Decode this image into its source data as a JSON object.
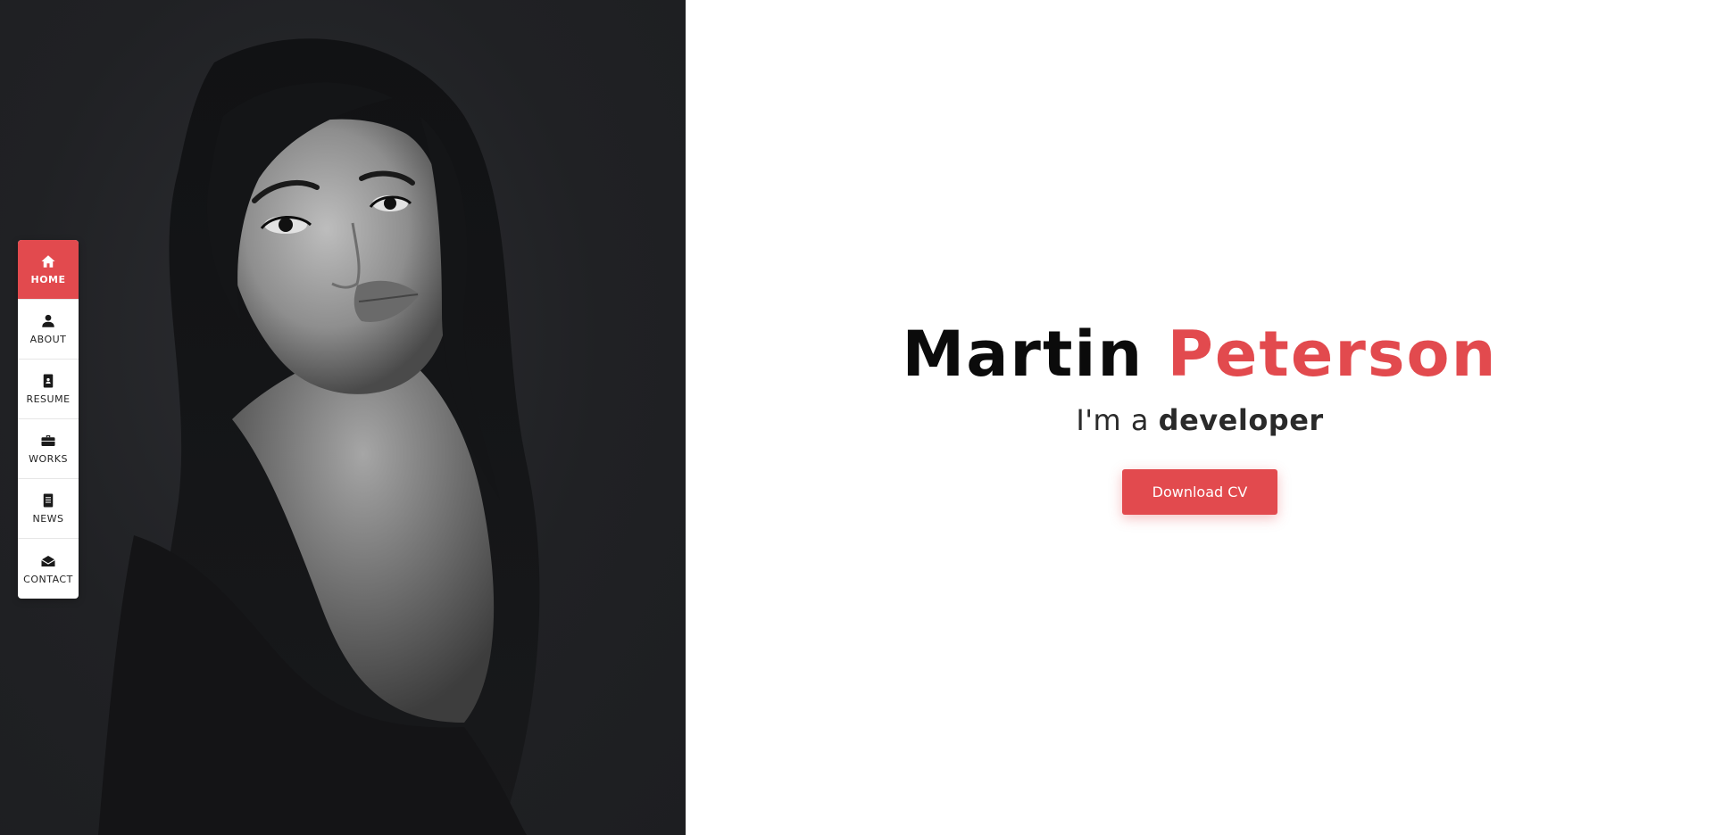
{
  "nav": {
    "items": [
      {
        "label": "HOME",
        "icon": "home-icon",
        "active": true
      },
      {
        "label": "ABOUT",
        "icon": "user-icon",
        "active": false
      },
      {
        "label": "RESUME",
        "icon": "id-card-icon",
        "active": false
      },
      {
        "label": "WORKS",
        "icon": "briefcase-icon",
        "active": false
      },
      {
        "label": "NEWS",
        "icon": "document-icon",
        "active": false
      },
      {
        "label": "CONTACT",
        "icon": "envelope-icon",
        "active": false
      }
    ]
  },
  "hero": {
    "first_name": "Martin",
    "last_name": "Peterson",
    "role_prefix": "I'm a",
    "role_word": "developer",
    "button_label": "Download CV"
  },
  "colors": {
    "accent": "#e24a4e",
    "panel_dark": "#202124",
    "text_dark": "#0b0b0b"
  }
}
